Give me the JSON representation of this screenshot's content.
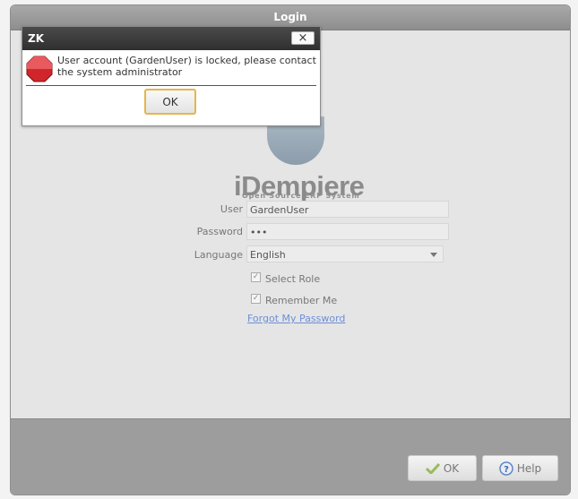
{
  "window": {
    "title": "Login"
  },
  "logo": {
    "name": "iDempiere",
    "tagline": "Open Source  ERP System"
  },
  "form": {
    "user_label": "User",
    "user_value": "GardenUser",
    "password_label": "Password",
    "password_value": "•••",
    "language_label": "Language",
    "language_value": "English",
    "select_role_label": "Select Role",
    "remember_me_label": "Remember Me",
    "forgot_password_label": "Forgot My Password"
  },
  "footer": {
    "ok_label": "OK",
    "help_label": "Help"
  },
  "dialog": {
    "title": "ZK",
    "close_glyph": "×",
    "message": "User account (GardenUser) is locked, please contact the system administrator",
    "ok_label": "OK",
    "icon": "stop-icon"
  },
  "colors": {
    "accent": "#e6b54a",
    "link": "#6c8fd6",
    "stop": "#d0262b"
  }
}
